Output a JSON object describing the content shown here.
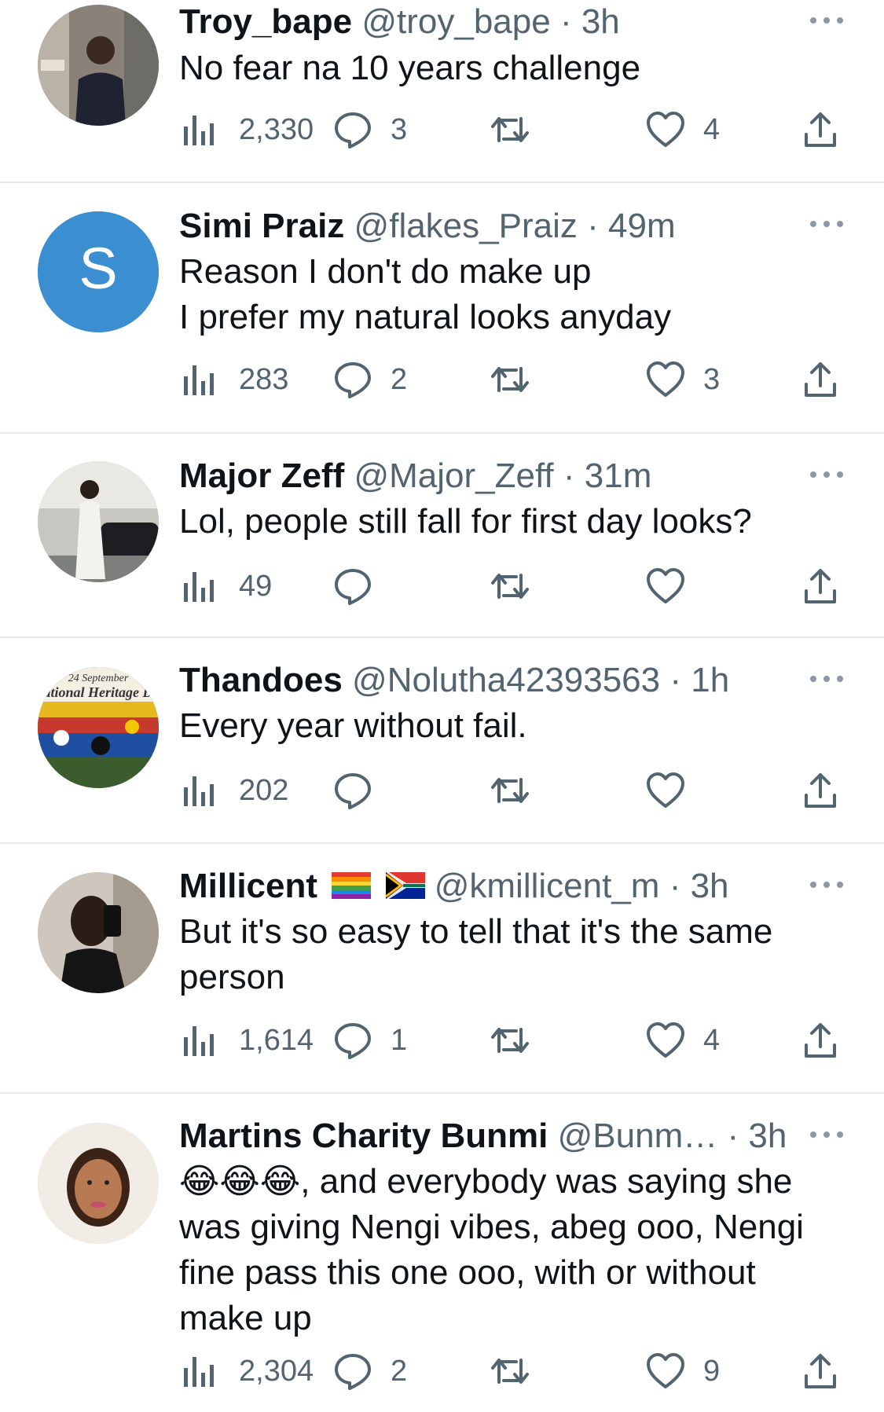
{
  "colors": {
    "text": "#0f1419",
    "muted": "#536471",
    "divider": "#e6e8eb",
    "avatar_blue": "#3b8ed0"
  },
  "tweets": [
    {
      "name": "Troy_bape",
      "handle": "@troy_bape",
      "separator": "·",
      "time": "3h",
      "text": "No fear na 10 years challenge",
      "views": "2,330",
      "replies": "3",
      "retweets": "",
      "likes": "4",
      "avatar": "photo"
    },
    {
      "name": "Simi Praiz",
      "handle": "@flakes_Praiz",
      "separator": "·",
      "time": "49m",
      "text": "Reason I don't do make up\nI prefer my natural looks anyday",
      "views": "283",
      "replies": "2",
      "retweets": "",
      "likes": "3",
      "avatar": "initial",
      "avatar_letter": "S"
    },
    {
      "name": "Major Zeff",
      "handle": "@Major_Zeff",
      "separator": "·",
      "time": "31m",
      "text": "Lol, people still fall for first day looks?",
      "views": "49",
      "replies": "",
      "retweets": "",
      "likes": "",
      "avatar": "photo"
    },
    {
      "name": "Thandoes",
      "handle": "@Nolutha42393563",
      "separator": "·",
      "time": "1h",
      "text": "Every year without fail.",
      "views": "202",
      "replies": "",
      "retweets": "",
      "likes": "",
      "avatar": "heritage",
      "avatar_caption_top": "24 September",
      "avatar_caption_bottom": "ational Heritage D"
    },
    {
      "name": "Millicent",
      "name_flags": [
        "rainbow-flag-icon",
        "south-africa-flag-icon"
      ],
      "handle": "@kmillicent_m",
      "separator": "·",
      "time": "3h",
      "text": "But it's so easy to tell that it's the same\nperson",
      "views": "1,614",
      "replies": "1",
      "retweets": "",
      "likes": "4",
      "avatar": "photo"
    },
    {
      "name": "Martins Charity Bunmi",
      "handle": "@Bunm…",
      "separator": "·",
      "time": "3h",
      "emoji": "😂😂😂",
      "text": ", and everybody was saying she\nwas giving Nengi vibes, abeg ooo, Nengi\nfine pass this one ooo, with or without\nmake up",
      "views": "2,304",
      "replies": "2",
      "retweets": "",
      "likes": "9",
      "avatar": "photo"
    }
  ]
}
